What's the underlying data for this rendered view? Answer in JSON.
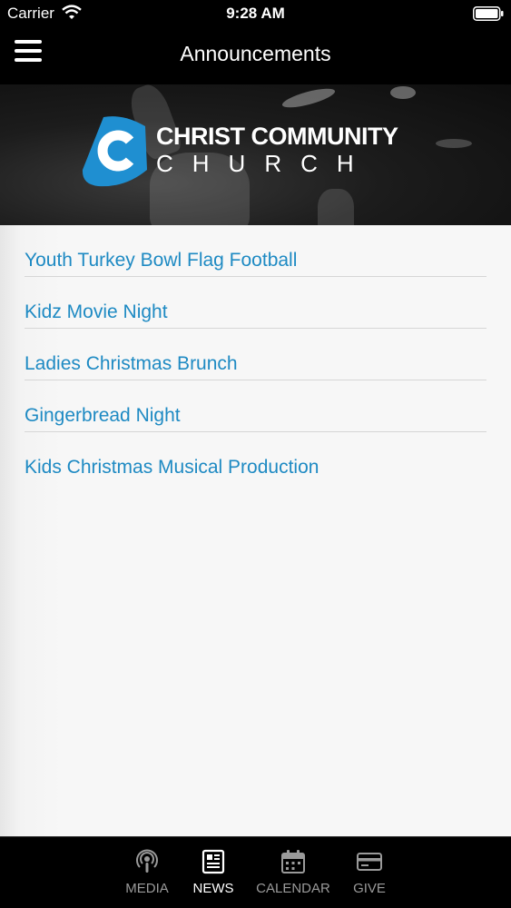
{
  "status_bar": {
    "carrier": "Carrier",
    "time": "9:28 AM"
  },
  "nav": {
    "title": "Announcements"
  },
  "banner": {
    "logo_line1": "CHRIST COMMUNITY",
    "logo_line2": "CHURCH"
  },
  "announcements": [
    "Youth Turkey Bowl Flag Football",
    "Kidz Movie Night",
    "Ladies Christmas Brunch",
    "Gingerbread Night",
    "Kids Christmas Musical Production"
  ],
  "tabs": [
    {
      "label": "MEDIA",
      "icon": "podcast-icon",
      "active": false
    },
    {
      "label": "NEWS",
      "icon": "newspaper-icon",
      "active": true
    },
    {
      "label": "CALENDAR",
      "icon": "calendar-icon",
      "active": false
    },
    {
      "label": "GIVE",
      "icon": "credit-card-icon",
      "active": false
    }
  ],
  "colors": {
    "accent": "#1e8ac3",
    "logo_blue": "#1f8fd1",
    "bar_bg": "#000000",
    "list_bg": "#f7f7f7"
  }
}
